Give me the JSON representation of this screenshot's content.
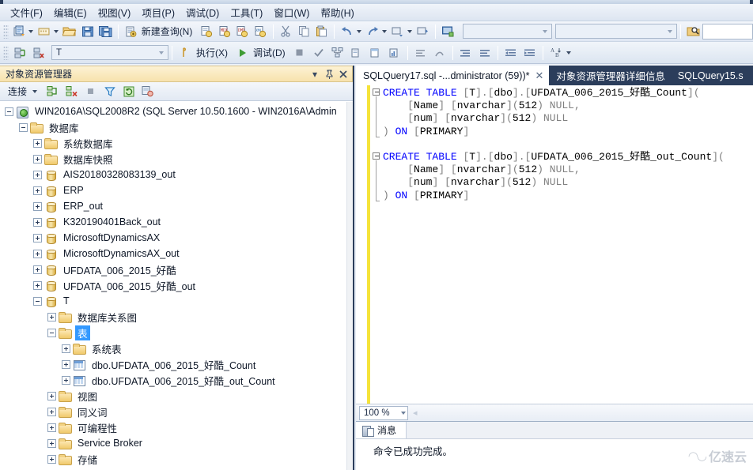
{
  "window": {
    "title_bar_visible": true
  },
  "menubar": {
    "items": [
      {
        "label": "文件(F)",
        "name": "menu-file"
      },
      {
        "label": "编辑(E)",
        "name": "menu-edit"
      },
      {
        "label": "视图(V)",
        "name": "menu-view"
      },
      {
        "label": "项目(P)",
        "name": "menu-project"
      },
      {
        "label": "调试(D)",
        "name": "menu-debug"
      },
      {
        "label": "工具(T)",
        "name": "menu-tools"
      },
      {
        "label": "窗口(W)",
        "name": "menu-window"
      },
      {
        "label": "帮助(H)",
        "name": "menu-help"
      }
    ]
  },
  "toolbar_main": {
    "new_query_label": "新建查询(N)",
    "icons": [
      "new-project-icon",
      "new-item-icon",
      "open-file-icon",
      "save-icon",
      "save-all-icon",
      "new-query-icon",
      "new-database-query-icon",
      "new-analysis-mdx-query-icon",
      "new-analysis-dmx-query-icon",
      "new-analysis-xmla-query-icon",
      "cut-icon",
      "copy-icon",
      "paste-icon",
      "undo-icon",
      "redo-icon",
      "navigate-backward-icon",
      "navigate-forward-icon",
      "registered-servers-icon",
      "start-debug-icon",
      "find-in-files-icon"
    ],
    "combo1_value": "",
    "combo2_value": "",
    "textbox_value": ""
  },
  "toolbar_sql": {
    "database_combo_value": "T",
    "execute_label": "执行(X)",
    "debug_label": "调试(D)",
    "icons": [
      "connect-icon",
      "disconnect-icon",
      "execute-icon",
      "debug-icon",
      "stop-icon",
      "parse-icon",
      "display-estimated-plan-icon",
      "query-options-icon",
      "include-actual-plan-icon",
      "include-client-statistics-icon",
      "results-to-text-icon",
      "results-to-grid-icon",
      "results-to-file-icon",
      "comment-icon",
      "uncomment-icon",
      "decrease-indent-icon",
      "increase-indent-icon",
      "specify-values-icon"
    ]
  },
  "object_explorer": {
    "title": "对象资源管理器",
    "header_buttons": [
      "dropdown-icon",
      "pin-icon",
      "close-icon"
    ],
    "toolbar": {
      "connect_label": "连接",
      "icons": [
        "connect-object-explorer-icon",
        "disconnect-object-explorer-icon",
        "stop-icon",
        "filter-icon",
        "refresh-icon",
        "script-icon"
      ]
    },
    "tree": [
      {
        "label": "WIN2016A\\SQL2008R2 (SQL Server 10.50.1600 - WIN2016A\\Admin",
        "indent": 0,
        "icon": "server",
        "expander": "minus",
        "selected": false
      },
      {
        "label": "数据库",
        "indent": 1,
        "icon": "folder",
        "expander": "minus",
        "selected": false
      },
      {
        "label": "系统数据库",
        "indent": 2,
        "icon": "folder",
        "expander": "plus",
        "selected": false
      },
      {
        "label": "数据库快照",
        "indent": 2,
        "icon": "folder",
        "expander": "plus",
        "selected": false
      },
      {
        "label": "AIS20180328083139_out",
        "indent": 2,
        "icon": "db",
        "expander": "plus",
        "selected": false
      },
      {
        "label": "ERP",
        "indent": 2,
        "icon": "db",
        "expander": "plus",
        "selected": false
      },
      {
        "label": "ERP_out",
        "indent": 2,
        "icon": "db",
        "expander": "plus",
        "selected": false
      },
      {
        "label": "K320190401Back_out",
        "indent": 2,
        "icon": "db",
        "expander": "plus",
        "selected": false
      },
      {
        "label": "MicrosoftDynamicsAX",
        "indent": 2,
        "icon": "db",
        "expander": "plus",
        "selected": false
      },
      {
        "label": "MicrosoftDynamicsAX_out",
        "indent": 2,
        "icon": "db",
        "expander": "plus",
        "selected": false
      },
      {
        "label": "UFDATA_006_2015_好酷",
        "indent": 2,
        "icon": "db",
        "expander": "plus",
        "selected": false
      },
      {
        "label": "UFDATA_006_2015_好酷_out",
        "indent": 2,
        "icon": "db",
        "expander": "plus",
        "selected": false
      },
      {
        "label": "T",
        "indent": 2,
        "icon": "db",
        "expander": "minus",
        "selected": false
      },
      {
        "label": "数据库关系图",
        "indent": 3,
        "icon": "folder",
        "expander": "plus",
        "selected": false
      },
      {
        "label": "表",
        "indent": 3,
        "icon": "folder",
        "expander": "minus",
        "selected": true
      },
      {
        "label": "系统表",
        "indent": 4,
        "icon": "folder",
        "expander": "plus",
        "selected": false
      },
      {
        "label": "dbo.UFDATA_006_2015_好酷_Count",
        "indent": 4,
        "icon": "table",
        "expander": "plus",
        "selected": false
      },
      {
        "label": "dbo.UFDATA_006_2015_好酷_out_Count",
        "indent": 4,
        "icon": "table",
        "expander": "plus",
        "selected": false
      },
      {
        "label": "视图",
        "indent": 3,
        "icon": "folder",
        "expander": "plus",
        "selected": false
      },
      {
        "label": "同义词",
        "indent": 3,
        "icon": "folder",
        "expander": "plus",
        "selected": false
      },
      {
        "label": "可编程性",
        "indent": 3,
        "icon": "folder",
        "expander": "plus",
        "selected": false
      },
      {
        "label": "Service Broker",
        "indent": 3,
        "icon": "folder",
        "expander": "plus",
        "selected": false
      },
      {
        "label": "存储",
        "indent": 3,
        "icon": "folder",
        "expander": "plus",
        "selected": false
      }
    ]
  },
  "editor": {
    "tabs": [
      {
        "label": "SQLQuery17.sql -...dministrator (59))*",
        "active": true,
        "closable": true
      },
      {
        "label": "对象资源管理器详细信息",
        "active": false,
        "closable": false
      },
      {
        "label": "SQLQuery15.s",
        "active": false,
        "closable": false
      }
    ],
    "code_lines": [
      "CREATE TABLE [T].[dbo].[UFDATA_006_2015_好酷_Count](",
      "    [Name] [nvarchar](512) NULL,",
      "    [num] [nvarchar](512) NULL",
      ") ON [PRIMARY]",
      "",
      "CREATE TABLE [T].[dbo].[UFDATA_006_2015_好酷_out_Count](",
      "    [Name] [nvarchar](512) NULL,",
      "    [num] [nvarchar](512) NULL",
      ") ON [PRIMARY]"
    ],
    "zoom_level": "100 %"
  },
  "results": {
    "tab_label": "消息",
    "message": "命令已成功完成。"
  },
  "watermark": {
    "text": "亿速云"
  },
  "colors": {
    "accent_dark": "#2b3d5b",
    "oe_header": "#f7e2ad",
    "selection": "#3399ff",
    "keyword": "#0000ff",
    "bracket": "#808080",
    "changebar": "#f5e33a"
  }
}
